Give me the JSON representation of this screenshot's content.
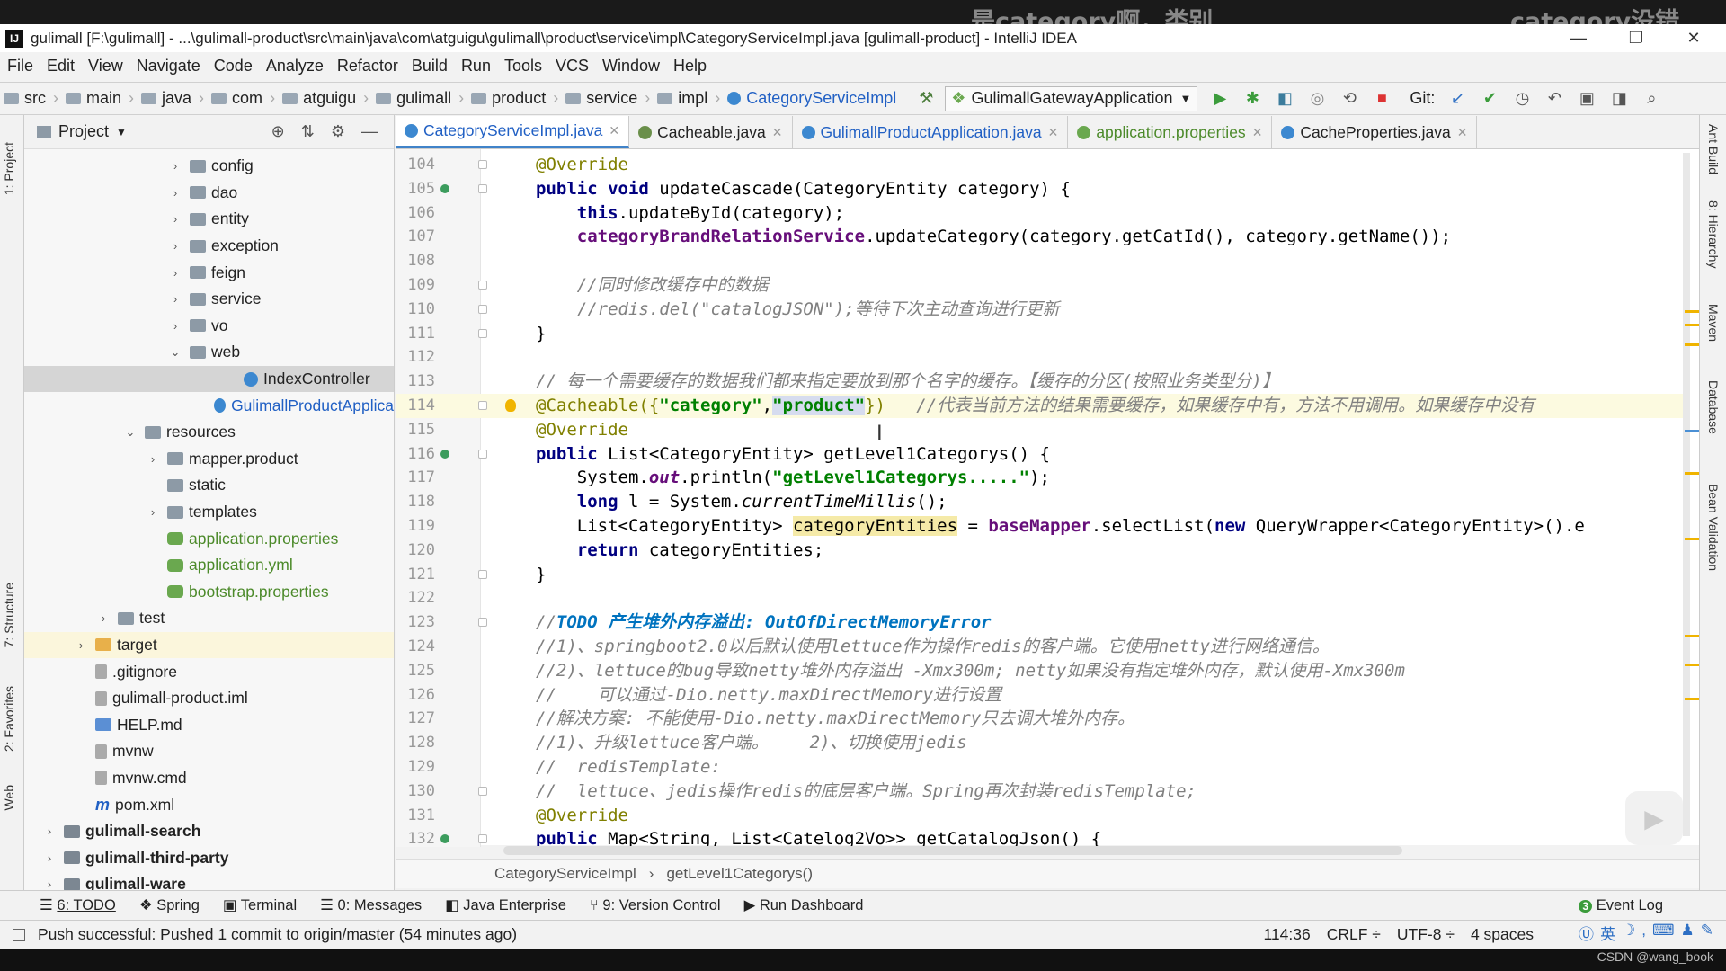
{
  "overlay": {
    "text1": "是category啊，类别",
    "text2": "category没错的，"
  },
  "window": {
    "title": "gulimall [F:\\gulimall] - ...\\gulimall-product\\src\\main\\java\\com\\atguigu\\gulimall\\product\\service\\impl\\CategoryServiceImpl.java [gulimall-product] - IntelliJ IDEA"
  },
  "menu": [
    "File",
    "Edit",
    "View",
    "Navigate",
    "Code",
    "Analyze",
    "Refactor",
    "Build",
    "Run",
    "Tools",
    "VCS",
    "Window",
    "Help"
  ],
  "breadcrumbs": [
    "src",
    "main",
    "java",
    "com",
    "atguigu",
    "gulimall",
    "product",
    "service",
    "impl"
  ],
  "breadcrumb_class": "CategoryServiceImpl",
  "run_config": "GulimallGatewayApplication",
  "git_label": "Git:",
  "project_panel": {
    "title": "Project"
  },
  "tree": [
    {
      "label": "config",
      "indent": 200,
      "arrow": "›"
    },
    {
      "label": "dao",
      "indent": 200,
      "arrow": "›"
    },
    {
      "label": "entity",
      "indent": 200,
      "arrow": "›"
    },
    {
      "label": "exception",
      "indent": 200,
      "arrow": "›"
    },
    {
      "label": "feign",
      "indent": 200,
      "arrow": "›"
    },
    {
      "label": "service",
      "indent": 200,
      "arrow": "›"
    },
    {
      "label": "vo",
      "indent": 200,
      "arrow": "›"
    },
    {
      "label": "web",
      "indent": 200,
      "arrow": "⌄"
    },
    {
      "label": "IndexController",
      "indent": 260,
      "arrow": "",
      "type": "java"
    },
    {
      "label": "GulimallProductApplica",
      "indent": 230,
      "arrow": "",
      "type": "java",
      "blue": true
    },
    {
      "label": "resources",
      "indent": 150,
      "arrow": "⌄"
    },
    {
      "label": "mapper.product",
      "indent": 175,
      "arrow": "›"
    },
    {
      "label": "static",
      "indent": 175,
      "arrow": ""
    },
    {
      "label": "templates",
      "indent": 175,
      "arrow": "›"
    },
    {
      "label": "application.properties",
      "indent": 175,
      "arrow": "",
      "type": "prop"
    },
    {
      "label": "application.yml",
      "indent": 175,
      "arrow": "",
      "type": "prop"
    },
    {
      "label": "bootstrap.properties",
      "indent": 175,
      "arrow": "",
      "type": "prop"
    },
    {
      "label": "test",
      "indent": 120,
      "arrow": "›"
    },
    {
      "label": "target",
      "indent": 95,
      "arrow": "›",
      "type": "tgt"
    },
    {
      "label": ".gitignore",
      "indent": 95,
      "arrow": "",
      "type": "file"
    },
    {
      "label": "gulimall-product.iml",
      "indent": 95,
      "arrow": "",
      "type": "file"
    },
    {
      "label": "HELP.md",
      "indent": 95,
      "arrow": "",
      "type": "md"
    },
    {
      "label": "mvnw",
      "indent": 95,
      "arrow": "",
      "type": "file"
    },
    {
      "label": "mvnw.cmd",
      "indent": 95,
      "arrow": "",
      "type": "file"
    },
    {
      "label": "pom.xml",
      "indent": 95,
      "arrow": "",
      "type": "m"
    },
    {
      "label": "gulimall-search",
      "indent": 60,
      "arrow": "›",
      "type": "mod",
      "bold": true
    },
    {
      "label": "gulimall-third-party",
      "indent": 60,
      "arrow": "›",
      "type": "mod",
      "bold": true
    },
    {
      "label": "gulimall-ware",
      "indent": 60,
      "arrow": "›",
      "type": "mod",
      "bold": true
    }
  ],
  "tabs": [
    "CategoryServiceImpl.java",
    "Cacheable.java",
    "GulimallProductApplication.java",
    "application.properties",
    "CacheProperties.java"
  ],
  "code": {
    "l104": {
      "n": "104",
      "t": "@Override"
    },
    "l105": {
      "n": "105",
      "a": "public void ",
      "b": "updateCascade(CategoryEntity category) {"
    },
    "l106": {
      "n": "106",
      "a": "this",
      "b": ".updateById(category);"
    },
    "l107": {
      "n": "107",
      "a": "categoryBrandRelationService",
      "b": ".updateCategory(category.getCatId(), category.getName());"
    },
    "l108": {
      "n": "108"
    },
    "l109": {
      "n": "109",
      "t": "//同时修改缓存中的数据"
    },
    "l110": {
      "n": "110",
      "t": "//redis.del(\"catalogJSON\");等待下次主动查询进行更新"
    },
    "l111": {
      "n": "111",
      "t": "}"
    },
    "l112": {
      "n": "112"
    },
    "l113": {
      "n": "113",
      "t": "// 每一个需要缓存的数据我们都来指定要放到那个名字的缓存。【缓存的分区(按照业务类型分)】"
    },
    "l114": {
      "n": "114",
      "a": "@Cacheable({",
      "s1": "\"category\"",
      "c": ",",
      "s2": "\"product\"",
      "d": "})",
      "e": "   //代表当前方法的结果需要缓存，如果缓存中有，方法不用调用。如果缓存中没有"
    },
    "l115": {
      "n": "115",
      "t": "@Override"
    },
    "l116": {
      "n": "116",
      "a": "public ",
      "b": "List<CategoryEntity> getLevel1Categorys() {"
    },
    "l117": {
      "n": "117",
      "a": "System.",
      "o": "out",
      "b": ".println(",
      "s": "\"getLevel1Categorys.....\"",
      "c": ");"
    },
    "l118": {
      "n": "118",
      "a": "long ",
      "b": "l = System.",
      "o": "currentTimeMillis",
      "c": "();"
    },
    "l119": {
      "n": "119",
      "a": "List<CategoryEntity> ",
      "v": "categoryEntities",
      "b": " = ",
      "f": "baseMapper",
      "c": ".selectList(",
      "k": "new ",
      "d": "QueryWrapper<CategoryEntity>().e"
    },
    "l120": {
      "n": "120",
      "a": "return ",
      "b": "categoryEntities;"
    },
    "l121": {
      "n": "121",
      "t": "}"
    },
    "l122": {
      "n": "122"
    },
    "l123": {
      "n": "123",
      "a": "//",
      "td": "TODO 产生堆外内存溢出: OutOfDirectMemoryError"
    },
    "l124": {
      "n": "124",
      "t": "//1)、springboot2.0以后默认使用lettuce作为操作redis的客户端。它使用netty进行网络通信。"
    },
    "l125": {
      "n": "125",
      "t": "//2)、lettuce的bug导致netty堆外内存溢出 -Xmx300m; netty如果没有指定堆外内存，默认使用-Xmx300m"
    },
    "l126": {
      "n": "126",
      "t": "//    可以通过-Dio.netty.maxDirectMemory进行设置"
    },
    "l127": {
      "n": "127",
      "t": "//解决方案: 不能使用-Dio.netty.maxDirectMemory只去调大堆外内存。"
    },
    "l128": {
      "n": "128",
      "t": "//1)、升级lettuce客户端。    2)、切换使用jedis"
    },
    "l129": {
      "n": "129",
      "t": "//  redisTemplate:"
    },
    "l130": {
      "n": "130",
      "t": "//  lettuce、jedis操作redis的底层客户端。Spring再次封装redisTemplate;"
    },
    "l131": {
      "n": "131",
      "t": "@Override"
    },
    "l132": {
      "n": "132",
      "a": "public ",
      "b": "Map<String, List<Catelog2Vo>> getCatalogJson() {"
    }
  },
  "editor_breadcrumb": [
    "CategoryServiceImpl",
    "getLevel1Categorys()"
  ],
  "bottom_tools": [
    "6: TODO",
    "Spring",
    "Terminal",
    "0: Messages",
    "Java Enterprise",
    "9: Version Control",
    "Run Dashboard"
  ],
  "event_log": "Event Log",
  "status": {
    "message": "Push successful: Pushed 1 commit to origin/master (54 minutes ago)",
    "pos": "114:36",
    "eol": "CRLF ÷",
    "enc": "UTF-8 ÷",
    "indent": "4 spaces"
  },
  "right_tabs": [
    "Ant Build",
    "8: Hierarchy",
    "Maven",
    "Database",
    "Bean Validation"
  ],
  "left_tabs": [
    "1: Project",
    "7: Structure",
    "2: Favorites",
    "Web"
  ],
  "watermark": "CSDN @wang_book",
  "ime_label": "英"
}
